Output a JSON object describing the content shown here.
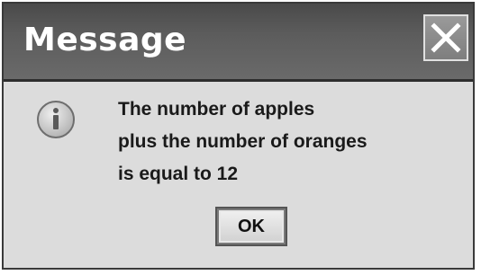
{
  "dialog": {
    "title": "Message",
    "message_lines": [
      "The number of apples",
      "plus the number of oranges",
      "is equal to 12"
    ],
    "ok_label": "OK",
    "icon": "information-icon",
    "close_icon": "close-icon"
  }
}
